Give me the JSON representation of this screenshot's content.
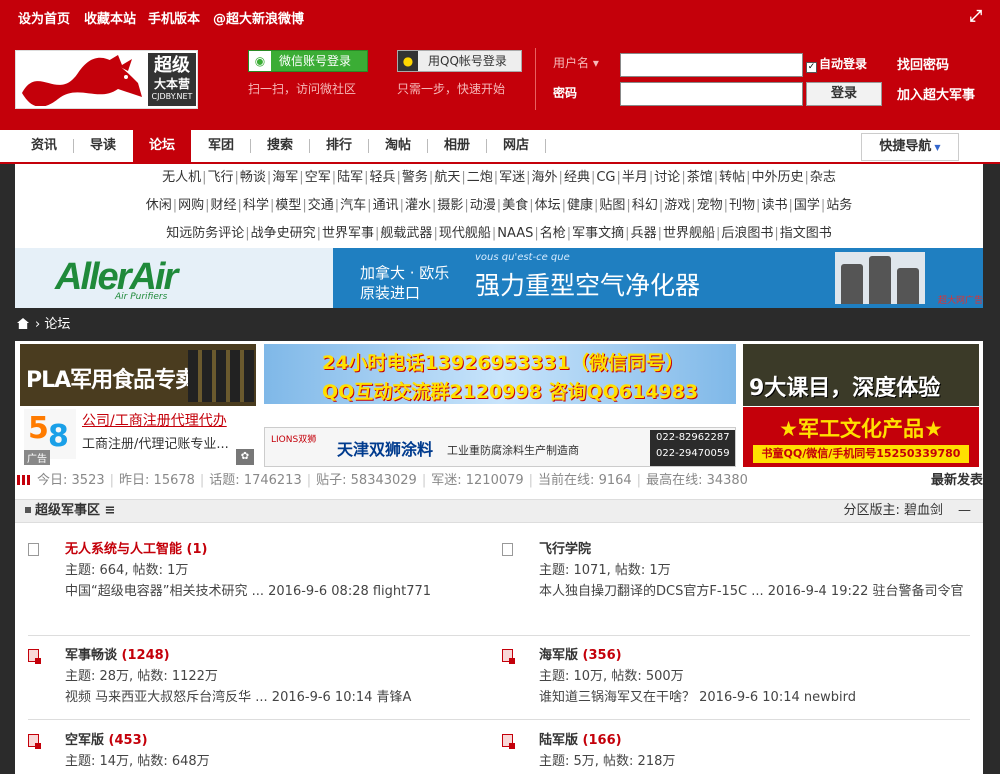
{
  "top_links": [
    "设为首页",
    "收藏本站",
    "手机版本",
    "@超大新浪微博"
  ],
  "fullscreen_icon": "expand-icon",
  "logo": {
    "title": "超级",
    "subtitle": "大本营",
    "domain": "CJDBY.NET"
  },
  "wechat": {
    "button": "微信账号登录",
    "tip": "扫一扫，访问微社区"
  },
  "qq": {
    "button": "用QQ帐号登录",
    "tip": "只需一步，快速开始"
  },
  "login": {
    "username_label": "用户名",
    "password_label": "密码",
    "auto_login": "自动登录",
    "submit": "登录",
    "find_password": "找回密码",
    "join": "加入超大军事"
  },
  "nav": {
    "items": [
      "资讯",
      "导读",
      "论坛",
      "军团",
      "搜索",
      "排行",
      "淘帖",
      "相册",
      "网店"
    ],
    "active": "论坛",
    "quick_nav": "快捷导航"
  },
  "subnav": {
    "row1": [
      "无人机",
      "飞行",
      "畅谈",
      "海军",
      "空军",
      "陆军",
      "轻兵",
      "警务",
      "航天",
      "二炮",
      "军迷",
      "海外",
      "经典",
      "CG",
      "半月",
      "讨论",
      "茶馆",
      "转帖",
      "中外历史",
      "杂志"
    ],
    "row2": [
      "休闲",
      "网购",
      "财经",
      "科学",
      "模型",
      "交通",
      "汽车",
      "通讯",
      "灌水",
      "摄影",
      "动漫",
      "美食",
      "体坛",
      "健康",
      "贴图",
      "科幻",
      "游戏",
      "宠物",
      "刊物",
      "读书",
      "国学",
      "站务"
    ],
    "row3": [
      "知远防务评论",
      "战争史研究",
      "世界军事",
      "舰载武器",
      "现代舰船",
      "NAAS",
      "名枪",
      "军事文摘",
      "兵器",
      "世界舰船",
      "后浪图书",
      "指文图书"
    ]
  },
  "banner": {
    "brand": "AllerAir",
    "brand_sub": "Air Purifiers",
    "line1": "加拿大 · 欧乐",
    "line2": "原装进口",
    "slogan_fr": "vous qu'est-ce que",
    "slogan": "强力重型空气净化器",
    "ad_tag": "超大网广告"
  },
  "breadcrumb": {
    "current": "论坛"
  },
  "ads": {
    "ad1": "PLA军用食品专卖",
    "ad2_line1": "24小时电话13926953331（微信同号）",
    "ad2_line2": "QQ互动交流群2120998 咨询QQ614983",
    "ad3": "9大课目，深度体验",
    "ad4_logo": "58",
    "ad4_title": "公司/工商注册代理代办",
    "ad4_desc": "工商注册/代理记账专业...",
    "ad4_tag": "广告",
    "ad5_name": "天津双狮涂料",
    "ad5_desc": "工业重防腐涂料生产制造商",
    "ad5_tel1": "022-82962287",
    "ad5_tel2": "022-29470059",
    "ad5_logo": "LIONS双狮",
    "ad6_title": "★军工文化产品★",
    "ad6_sub": "书童QQ/微信/手机同号15250339780"
  },
  "stats": {
    "today_label": "今日:",
    "today": "3523",
    "yesterday_label": "昨日:",
    "yesterday": "15678",
    "topics_label": "话题:",
    "topics": "1746213",
    "posts_label": "贴子:",
    "posts": "58343029",
    "members_label": "军迷:",
    "members": "1210079",
    "online_label": "当前在线:",
    "online": "9164",
    "max_online_label": "最高在线:",
    "max_online": "34380",
    "new_posts": "最新发表"
  },
  "forum": {
    "title": "超级军事区",
    "moderator_label": "分区版主:",
    "moderator": "碧血剑",
    "collapse": "—",
    "boards": [
      {
        "name": "无人系统与人工智能",
        "count": "(1)",
        "meta": "主题: 664, 帖数: 1万",
        "last": "中国“超级电容器”相关技术研究 ... 2016-9-6 08:28 flight771",
        "highlight": true
      },
      {
        "name": "飞行学院",
        "count": "",
        "meta": "主题: 1071, 帖数: 1万",
        "last": "本人独自操刀翻译的DCS官方F-15C ... 2016-9-4 19:22 驻台警备司令官",
        "highlight": false
      },
      {
        "name": "军事畅谈",
        "count": "(1248)",
        "meta": "主题: 28万, 帖数: 1122万",
        "last": "视频 马来西亚大叔怒斥台湾反华 ... 2016-9-6 10:14 青锋A",
        "highlight": false
      },
      {
        "name": "海军版",
        "count": "(356)",
        "meta": "主题: 10万, 帖数: 500万",
        "last": "谁知道三锅海军又在干啥？ 2016-9-6 10:14 newbird",
        "highlight": false
      },
      {
        "name": "空军版",
        "count": "(453)",
        "meta": "主题: 14万, 帖数: 648万",
        "last": "",
        "highlight": false
      },
      {
        "name": "陆军版",
        "count": "(166)",
        "meta": "主题: 5万, 帖数: 218万",
        "last": "",
        "highlight": false
      }
    ]
  }
}
